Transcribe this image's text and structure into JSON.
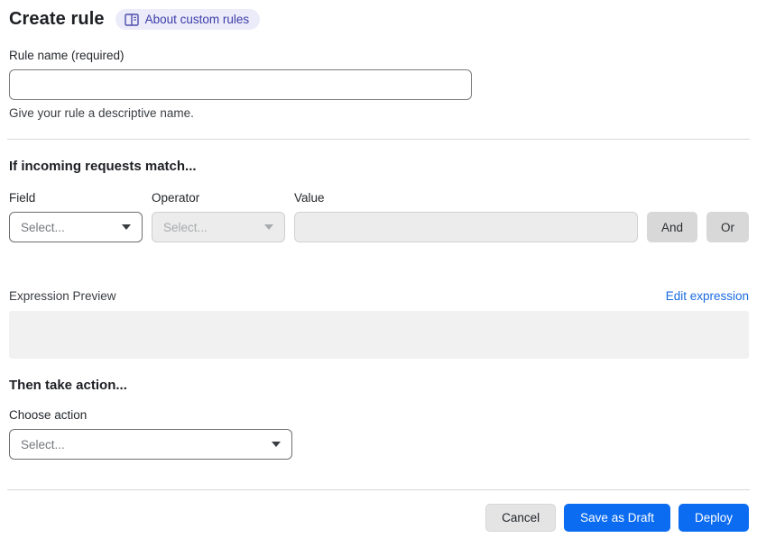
{
  "header": {
    "title": "Create rule",
    "about_link": "About custom rules"
  },
  "rule_name": {
    "label": "Rule name (required)",
    "value": "",
    "helper": "Give your rule a descriptive name."
  },
  "match_section": {
    "heading": "If incoming requests match...",
    "field": {
      "label": "Field",
      "placeholder": "Select..."
    },
    "operator": {
      "label": "Operator",
      "placeholder": "Select..."
    },
    "value": {
      "label": "Value",
      "value": ""
    },
    "and_button": "And",
    "or_button": "Or",
    "expression_preview_label": "Expression Preview",
    "edit_expression_link": "Edit expression",
    "expression_value": ""
  },
  "action_section": {
    "heading": "Then take action...",
    "choose_action_label": "Choose action",
    "placeholder": "Select..."
  },
  "footer": {
    "cancel": "Cancel",
    "save_draft": "Save as Draft",
    "deploy": "Deploy"
  },
  "colors": {
    "primary_blue": "#0b6cf1",
    "link_blue": "#1a6be0",
    "badge_bg": "#ecebf9",
    "badge_text": "#3b3daa",
    "disabled_bg": "#ececec",
    "preview_bg": "#f1f1f1",
    "gray_button_bg": "#d8d8d8"
  }
}
